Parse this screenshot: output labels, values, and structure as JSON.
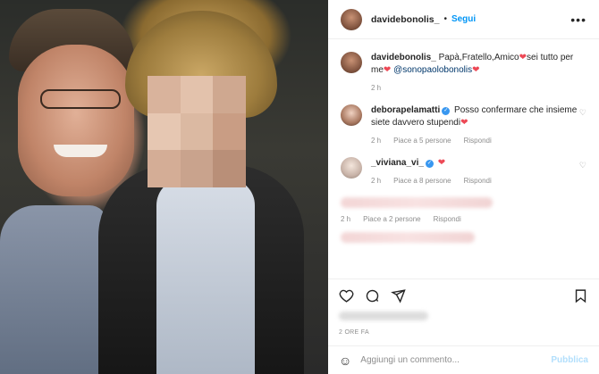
{
  "post": {
    "username": "davidebonolis_",
    "follow_label": "Segui",
    "caption": {
      "text_before": "Papà,Fratello,Amico",
      "text_after": "sei tutto per me",
      "mention": "@sonopaolobonolis",
      "time": "2 h"
    }
  },
  "comments": [
    {
      "username": "deborapelamatti",
      "verified": true,
      "text": "Posso confermare che insieme siete davvero stupendi",
      "time": "2 h",
      "likes": "Piace a 5 persone",
      "reply": "Rispondi"
    },
    {
      "username": "_viviana_vi_",
      "verified": true,
      "text": "",
      "time": "2 h",
      "likes": "Piace a 8 persone",
      "reply": "Rispondi"
    },
    {
      "time": "2 h",
      "likes": "Piace a 2 persone",
      "reply": "Rispondi"
    }
  ],
  "footer": {
    "time_ago": "2 ORE FA",
    "comment_placeholder": "Aggiungi un commento...",
    "publish_label": "Pubblica"
  },
  "icons": {
    "more": "more-options-icon",
    "like": "heart-icon",
    "comment": "comment-icon",
    "share": "send-icon",
    "save": "bookmark-icon",
    "emoji": "emoji-icon"
  },
  "colors": {
    "link": "#0095f6",
    "heart": "#ed4956",
    "verified": "#3897f0"
  }
}
